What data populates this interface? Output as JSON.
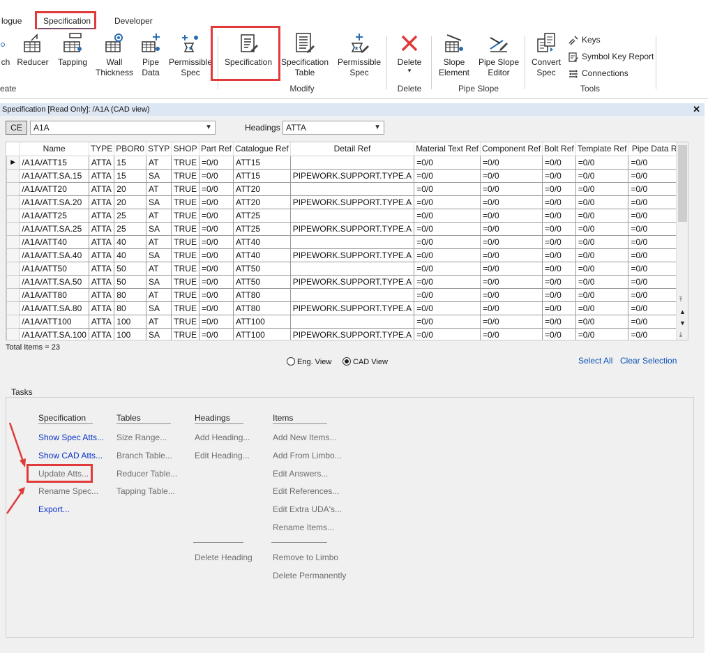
{
  "tabs": [
    "logue",
    "Specification",
    "Developer"
  ],
  "ribbon": {
    "create_buttons": [
      {
        "label": "ch",
        "icon": "branch-icon"
      },
      {
        "label": "Reducer",
        "icon": "reducer-icon"
      },
      {
        "label": "Tapping",
        "icon": "tapping-icon"
      },
      {
        "label": "Wall\nThickness",
        "icon": "wall-thickness-icon"
      },
      {
        "label": "Pipe\nData",
        "icon": "pipe-data-icon"
      },
      {
        "label": "Permissible\nSpec",
        "icon": "permissible-spec-icon"
      }
    ],
    "create_group": "reate",
    "modify_buttons": [
      {
        "label": "Specification",
        "icon": "specification-icon"
      },
      {
        "label": "Specification\nTable",
        "icon": "specification-table-icon"
      },
      {
        "label": "Permissible\nSpec",
        "icon": "permissible-spec-edit-icon"
      }
    ],
    "modify_group": "Modify",
    "delete_button": {
      "label": "Delete",
      "icon": "delete-x-icon"
    },
    "delete_group": "Delete",
    "slope_buttons": [
      {
        "label": "Slope\nElement",
        "icon": "slope-element-icon"
      },
      {
        "label": "Pipe Slope\nEditor",
        "icon": "pipe-slope-editor-icon"
      }
    ],
    "slope_group": "Pipe Slope",
    "convert_button": {
      "label": "Convert\nSpec",
      "icon": "convert-spec-icon"
    },
    "tools_small": [
      {
        "label": "Keys",
        "icon": "keys-icon"
      },
      {
        "label": "Symbol Key Report",
        "icon": "symbol-key-report-icon"
      },
      {
        "label": "Connections",
        "icon": "connections-icon"
      }
    ],
    "tools_group": "Tools"
  },
  "panel": {
    "title": "Specification [Read Only]: /A1A (CAD view)",
    "ce_label": "CE",
    "spec_value": "A1A",
    "headings_label": "Headings",
    "headings_value": "ATTA"
  },
  "grid": {
    "columns": [
      "Name",
      "TYPE",
      "PBOR0",
      "STYP",
      "SHOP",
      "Part Ref",
      "Catalogue Ref",
      "Detail Ref",
      "Material Text Ref",
      "Component Ref",
      "Bolt Ref",
      "Template Ref",
      "Pipe Data Ref"
    ],
    "rows": [
      [
        "/A1A/ATT15",
        "ATTA",
        "15",
        "AT",
        "TRUE",
        "=0/0",
        "ATT15",
        "",
        "=0/0",
        "=0/0",
        "=0/0",
        "=0/0",
        "=0/0"
      ],
      [
        "/A1A/ATT.SA.15",
        "ATTA",
        "15",
        "SA",
        "TRUE",
        "=0/0",
        "ATT15",
        "PIPEWORK.SUPPORT.TYPE.A",
        "=0/0",
        "=0/0",
        "=0/0",
        "=0/0",
        "=0/0"
      ],
      [
        "/A1A/ATT20",
        "ATTA",
        "20",
        "AT",
        "TRUE",
        "=0/0",
        "ATT20",
        "",
        "=0/0",
        "=0/0",
        "=0/0",
        "=0/0",
        "=0/0"
      ],
      [
        "/A1A/ATT.SA.20",
        "ATTA",
        "20",
        "SA",
        "TRUE",
        "=0/0",
        "ATT20",
        "PIPEWORK.SUPPORT.TYPE.A",
        "=0/0",
        "=0/0",
        "=0/0",
        "=0/0",
        "=0/0"
      ],
      [
        "/A1A/ATT25",
        "ATTA",
        "25",
        "AT",
        "TRUE",
        "=0/0",
        "ATT25",
        "",
        "=0/0",
        "=0/0",
        "=0/0",
        "=0/0",
        "=0/0"
      ],
      [
        "/A1A/ATT.SA.25",
        "ATTA",
        "25",
        "SA",
        "TRUE",
        "=0/0",
        "ATT25",
        "PIPEWORK.SUPPORT.TYPE.A",
        "=0/0",
        "=0/0",
        "=0/0",
        "=0/0",
        "=0/0"
      ],
      [
        "/A1A/ATT40",
        "ATTA",
        "40",
        "AT",
        "TRUE",
        "=0/0",
        "ATT40",
        "",
        "=0/0",
        "=0/0",
        "=0/0",
        "=0/0",
        "=0/0"
      ],
      [
        "/A1A/ATT.SA.40",
        "ATTA",
        "40",
        "SA",
        "TRUE",
        "=0/0",
        "ATT40",
        "PIPEWORK.SUPPORT.TYPE.A",
        "=0/0",
        "=0/0",
        "=0/0",
        "=0/0",
        "=0/0"
      ],
      [
        "/A1A/ATT50",
        "ATTA",
        "50",
        "AT",
        "TRUE",
        "=0/0",
        "ATT50",
        "",
        "=0/0",
        "=0/0",
        "=0/0",
        "=0/0",
        "=0/0"
      ],
      [
        "/A1A/ATT.SA.50",
        "ATTA",
        "50",
        "SA",
        "TRUE",
        "=0/0",
        "ATT50",
        "PIPEWORK.SUPPORT.TYPE.A",
        "=0/0",
        "=0/0",
        "=0/0",
        "=0/0",
        "=0/0"
      ],
      [
        "/A1A/ATT80",
        "ATTA",
        "80",
        "AT",
        "TRUE",
        "=0/0",
        "ATT80",
        "",
        "=0/0",
        "=0/0",
        "=0/0",
        "=0/0",
        "=0/0"
      ],
      [
        "/A1A/ATT.SA.80",
        "ATTA",
        "80",
        "SA",
        "TRUE",
        "=0/0",
        "ATT80",
        "PIPEWORK.SUPPORT.TYPE.A",
        "=0/0",
        "=0/0",
        "=0/0",
        "=0/0",
        "=0/0"
      ],
      [
        "/A1A/ATT100",
        "ATTA",
        "100",
        "AT",
        "TRUE",
        "=0/0",
        "ATT100",
        "",
        "=0/0",
        "=0/0",
        "=0/0",
        "=0/0",
        "=0/0"
      ],
      [
        "/A1A/ATT.SA.100",
        "ATTA",
        "100",
        "SA",
        "TRUE",
        "=0/0",
        "ATT100",
        "PIPEWORK.SUPPORT.TYPE.A",
        "=0/0",
        "=0/0",
        "=0/0",
        "=0/0",
        "=0/0"
      ]
    ],
    "total": "Total Items = 23"
  },
  "view": {
    "eng_view": "Eng. View",
    "cad_view": "CAD View",
    "selected": "CAD View"
  },
  "links": {
    "select_all": "Select All",
    "clear_selection": "Clear Selection"
  },
  "tasks": {
    "label": "Tasks",
    "specification": {
      "heading": "Specification",
      "items": [
        {
          "label": "Show Spec Atts...",
          "style": "blue"
        },
        {
          "label": "Show CAD Atts...",
          "style": "blue"
        },
        {
          "label": "Update Atts...",
          "style": "gray"
        },
        {
          "label": "Rename Spec...",
          "style": "gray"
        },
        {
          "label": "Export...",
          "style": "blue"
        }
      ]
    },
    "tables": {
      "heading": "Tables",
      "items": [
        "Size Range...",
        "Branch Table...",
        "Reducer Table...",
        "Tapping Table..."
      ]
    },
    "headings": {
      "heading": "Headings",
      "items": [
        "Add Heading...",
        "Edit Heading..."
      ],
      "bottom": [
        "Delete Heading"
      ]
    },
    "items": {
      "heading": "Items",
      "items": [
        "Add New Items...",
        "Add From Limbo...",
        "Edit Answers...",
        "Edit References...",
        "Edit Extra UDA's...",
        "Rename Items..."
      ],
      "bottom": [
        "Remove to Limbo",
        "Delete Permanently"
      ]
    }
  },
  "colors": {
    "highlight": "#e03a3a",
    "link": "#0a33c8",
    "titlebar": "#dde6f3"
  }
}
